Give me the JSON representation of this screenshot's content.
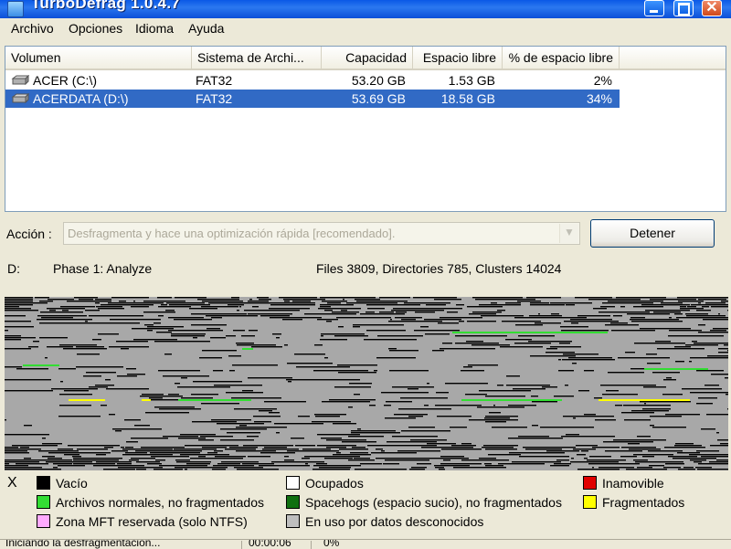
{
  "window": {
    "title": "TurboDefrag 1.0.4.7"
  },
  "menu": [
    "Archivo",
    "Opciones",
    "Idioma",
    "Ayuda"
  ],
  "table": {
    "columns": [
      "Volumen",
      "Sistema de Archi...",
      "Capacidad",
      "Espacio libre",
      "% de espacio libre"
    ],
    "rows": [
      {
        "volume": "ACER (C:\\)",
        "fs": "FAT32",
        "capacity": "53.20 GB",
        "free": "1.53 GB",
        "pct": "2%",
        "selected": false
      },
      {
        "volume": "ACERDATA (D:\\)",
        "fs": "FAT32",
        "capacity": "53.69 GB",
        "free": "18.58 GB",
        "pct": "34%",
        "selected": true
      }
    ]
  },
  "action": {
    "label": "Acción :",
    "selected": "Desfragmenta y hace una optimización rápida [recomendado].",
    "button": "Detener"
  },
  "status": {
    "drive": "D:",
    "phase": "Phase 1: Analyze",
    "stats": "Files 3809, Directories 785, Clusters 14024"
  },
  "legend": {
    "close": "X",
    "items": [
      {
        "label": "Vacío",
        "color": "#000000"
      },
      {
        "label": "Ocupados",
        "color": "#ffffff"
      },
      {
        "label": "Inamovible",
        "color": "#e00000"
      },
      {
        "label": "Archivos normales, no fragmentados",
        "color": "#33dd33"
      },
      {
        "label": "Spacehogs (espacio sucio), no fragmentados",
        "color": "#107010"
      },
      {
        "label": "Fragmentados",
        "color": "#ffff00"
      },
      {
        "label": "Zona MFT reservada (solo NTFS)",
        "color": "#ffaaff"
      },
      {
        "label": "En uso por datos desconocidos",
        "color": "#bebebe"
      }
    ]
  },
  "statusbar": {
    "text": "Iniciando la desfragmentación...",
    "time": "00:00:06",
    "pct": "0%"
  },
  "colors": {
    "selection": "#316ac5",
    "map_gray": "#a8a8a8",
    "map_black": "#000000",
    "map_green": "#33dd33",
    "map_yellow": "#ffff00"
  }
}
